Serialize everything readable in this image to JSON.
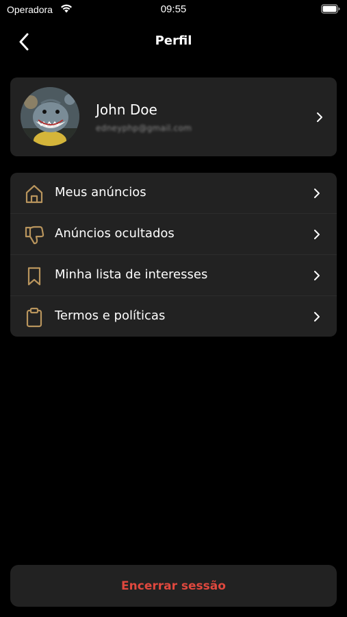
{
  "status_bar": {
    "carrier": "Operadora",
    "time": "09:55"
  },
  "nav": {
    "title": "Perfil"
  },
  "profile": {
    "name": "John Doe",
    "email": "edneyphp@gmail.com"
  },
  "menu": {
    "items": [
      {
        "label": "Meus anúncios",
        "icon": "home-icon"
      },
      {
        "label": "Anúncios ocultados",
        "icon": "thumbs-down-icon"
      },
      {
        "label": "Minha lista de interesses",
        "icon": "bookmark-icon"
      },
      {
        "label": "Termos e políticas",
        "icon": "clipboard-icon"
      }
    ]
  },
  "logout": {
    "label": "Encerrar sessão"
  },
  "colors": {
    "accent_icon": "#b9955d",
    "card_bg": "#222222",
    "logout_text": "#e0483e",
    "background": "#000000"
  }
}
